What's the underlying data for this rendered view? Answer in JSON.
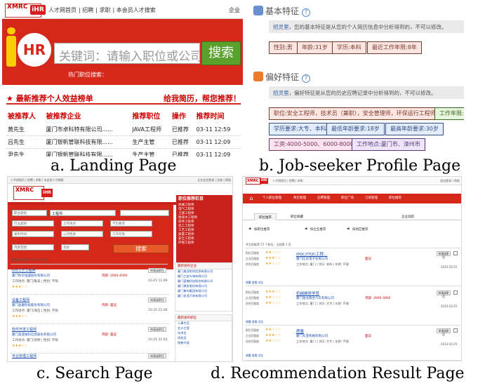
{
  "landing": {
    "logo_text": "XMRC",
    "logo_ihr": "iHR",
    "nav": [
      "人才网首页",
      "招聘",
      "求职",
      "本会员人才搜索"
    ],
    "top_right": "企业",
    "search_placeholder": "关键词：请输入职位或公司",
    "search_button": "搜索",
    "hot_label": "热门职位搜索：",
    "list_title": "最新推荐个人效益榜单",
    "list_right": "给我简历，帮您推荐！",
    "columns": [
      "被推荐人",
      "被推荐企业",
      "推荐职位",
      "操作",
      "推荐时间"
    ],
    "rows": [
      [
        "黄先生",
        "厦门市卓科特有限公司......",
        "JAVA工程师",
        "已推荐",
        "03-11 12:59"
      ],
      [
        "吕先生",
        "厦门银帆管联科技有限......",
        "生产主管",
        "已推荐",
        "03-11 12:09"
      ],
      [
        "尹先生",
        "厦门银帆管联科技有限......",
        "生产主管",
        "已推荐",
        "03-11 12:09"
      ]
    ]
  },
  "profile": {
    "basic_title": "基本特征",
    "basic_note_name": "招灵里",
    "basic_note": "，您的基本特征是从您的个人简历信息中分析得到的，不可以修改。",
    "basic_tags": [
      "性别:男",
      "年龄:31岁",
      "学历:本科",
      "最近工作年限:8年"
    ],
    "pref_title": "偏好特征",
    "pref_note_name": "招灵里",
    "pref_note": "，偏好特征是从您的历史应聘记录中分析得到的，不可以修改。",
    "pref_tags": [
      "职位:安全工程师，技术员（兼职），安全管理师，环保运行工程师",
      "工作年限:不",
      "学历要求:大专、本科",
      "最低年龄要求:18岁",
      "最高年龄要求:30岁",
      "工资:4000-5000、6000-8000",
      "工作地点:厦门市、漳州市"
    ]
  },
  "search": {
    "top_left": "人才网首页  |  招聘  |  求职  |  本会员人才搜索",
    "top_right": "企业会员登录  |  注册  |  帮助",
    "logo_text": "XMRC",
    "logo_ihr": "iHR",
    "sel_industry": "职业类别",
    "keyword": "工程师",
    "selects": [
      "行业类别",
      "工作地点",
      "学历要求",
      "发布时间",
      "公司性质",
      "工作年限",
      "月薪范围",
      "年龄"
    ],
    "search_button": "搜索",
    "side_title": "职位推荐栏目",
    "side_items": [
      "机械工程师",
      "电气工程师",
      "土建工程师",
      "给排水工程师",
      "软件工程师",
      "化工工程师",
      "工艺工程师",
      "质量工程师",
      "安全工程师",
      "环保工程师"
    ],
    "list_header": "找到相关职位 共 7810 条",
    "rows": [
      {
        "title": "IOS工艺工程师",
        "company": "厦门科华恒盛股份有限公司",
        "info": "工作地点: 厦门/集美 | 性别: 不限",
        "salary": "月薪: 2000-4000",
        "date": "10-25 11:09",
        "btn": "申请该职位"
      },
      {
        "title": "设备工程师",
        "company": "厦门盈趣科技股份有限公司",
        "info": "工作地点: 厦门/海沧 | 性别: 不限",
        "salary": "月薪: 面议",
        "date": "10-25 11:06",
        "btn": "申请该职位"
      },
      {
        "title": "软件开发工程师",
        "company": "厦门美亚柏科信息股份有限公司",
        "info": "工作地点: 厦门/思明 | 性别: 不限",
        "salary": "月薪: 面议",
        "date": "10-25 11:03",
        "btn": "申请该职位"
      },
      {
        "title": "专业管理工程师",
        "company": "厦门安妮股份有限公司",
        "info": "工作地点: 厦门/湖里 | 性别: 不限",
        "salary": "月薪: 面议",
        "date": "10-25 11:01",
        "btn": "申请该职位"
      }
    ],
    "side2_title": "最新发布企业",
    "side2_items": [
      "厦门美亚柏科信息有限公司",
      "厦门三安光电有限公司",
      "厦门盈趣科技股份有限公司",
      "厦门建发股份有限公司",
      "厦门象屿集团有限公司",
      "厦门金龙汽车有限公司"
    ],
    "side3_title": "最新发布职位",
    "side3_items": [
      "人事专员",
      "会计主管",
      "技术员",
      "质检员",
      "销售代表"
    ]
  },
  "recommend": {
    "logo_text": "XMRC",
    "logo_ihr": "iHR",
    "top_left": "人才网首页  |  招聘  |  求职",
    "top_right": "退出登录  |  帮助",
    "nav": [
      "个人职位管理",
      "简历管理",
      "应聘管理",
      "职位广场",
      "订阅管理",
      "职位推荐"
    ],
    "tab_on": "职位推荐",
    "tab2": "职位收藏",
    "tab_right": "企业追踪",
    "filters": [
      "按职位推荐",
      "按企业推荐",
      "按地区推荐"
    ],
    "summary": "共为您推荐 57 个职位，当前第 1 页",
    "rows": [
      {
        "title": "iPQC/ITQC工程...",
        "company": "厦门信达电子有限公司",
        "info": "工作地点: 厦门 | 学历: 本科 | 年龄: 不限",
        "pay": "面议",
        "date": "2013-10-25",
        "btn": "申请该职位",
        "bot": "收藏  查看  对比"
      },
      {
        "title": "机械维修学员",
        "company": "厦门金龙联合汽车有限公司",
        "info": "工作地点: 厦门 | 学历: 大专 | 年龄: 不限",
        "pay": "月薪: 2000-3000",
        "date": "2013-10-25",
        "btn": "申请该职位",
        "bot": "收藏  查看  对比"
      },
      {
        "title": "质量",
        "company": "厦门东亚机械有限公司",
        "info": "工作地点: 厦门 | 学历: 大专 | 年龄: 不限",
        "pay": "面议",
        "date": "2013-10-25",
        "btn": "申请该职位",
        "bot": "收藏  查看  对比"
      }
    ],
    "row_keys": [
      "职位匹配度",
      "企业匹配度",
      "综合匹配度"
    ]
  },
  "captions": {
    "a": "a. Landing Page",
    "b": "b. Job-seeker Profile Page",
    "c": "c. Search Page",
    "d": "d. Recommendation Result Page"
  },
  "colors": {
    "brand_red": "#d5281a",
    "search_green": "#5aa12d",
    "link_blue": "#1a4fb0"
  }
}
